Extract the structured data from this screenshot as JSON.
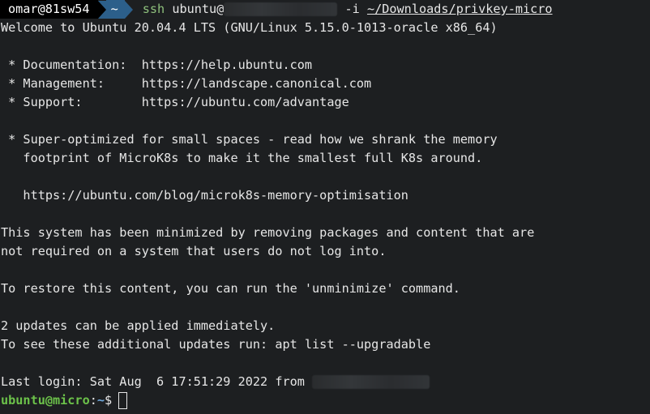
{
  "prompt": {
    "user_host": "omar@81sw54",
    "dir": "~",
    "ssh_cmd": "ssh",
    "ssh_target": "ubuntu@",
    "flag": "-i",
    "key_path": "~/Downloads/privkey-micro"
  },
  "motd": {
    "welcome": "Welcome to Ubuntu 20.04.4 LTS (GNU/Linux 5.15.0-1013-oracle x86_64)",
    "doc_line": " * Documentation:  https://help.ubuntu.com",
    "mgmt_line": " * Management:     https://landscape.canonical.com",
    "support_line": " * Support:        https://ubuntu.com/advantage",
    "optim1": " * Super-optimized for small spaces - read how we shrank the memory",
    "optim2": "   footprint of MicroK8s to make it the smallest full K8s around.",
    "blog": "   https://ubuntu.com/blog/microk8s-memory-optimisation",
    "min1": "This system has been minimized by removing packages and content that are",
    "min2": "not required on a system that users do not log into.",
    "restore": "To restore this content, you can run the 'unminimize' command.",
    "updates1": "2 updates can be applied immediately.",
    "updates2": "To see these additional updates run: apt list --upgradable",
    "last_login": "Last login: Sat Aug  6 17:51:29 2022 from "
  },
  "shell": {
    "user_host": "ubuntu@micro",
    "colon": ":",
    "path": "~",
    "dollar": "$"
  },
  "colors": {
    "background": "#1d1f21",
    "foreground": "#e6e6e6",
    "prompt_user_bg": "#000000",
    "prompt_dir_bg": "#2c5f8a",
    "ssh_green": "#8ec07c",
    "ps1_green": "#6cc24a",
    "ps1_blue": "#6fa8dc"
  }
}
